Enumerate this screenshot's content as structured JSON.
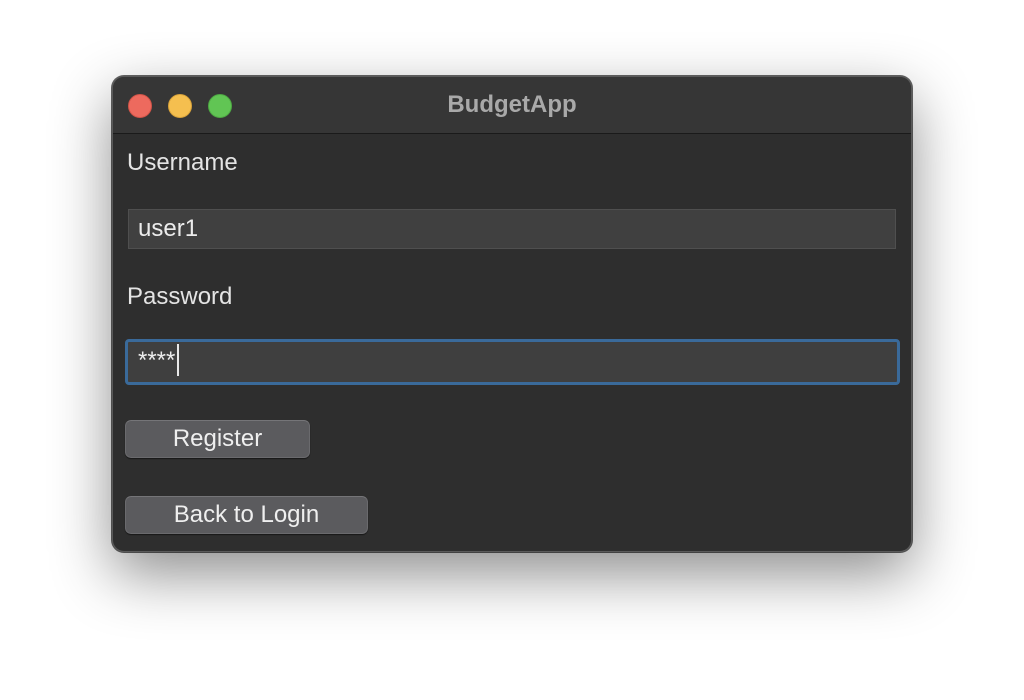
{
  "window": {
    "title": "BudgetApp"
  },
  "form": {
    "username_label": "Username",
    "username_value": "user1",
    "password_label": "Password",
    "password_value": "****"
  },
  "buttons": {
    "register_label": "Register",
    "back_label": "Back to Login"
  },
  "colors": {
    "window_bg": "#2e2e2e",
    "focus_ring": "#3a6a9a",
    "close": "#ed6a5e",
    "minimize": "#f5bf4f",
    "maximize": "#61c554"
  }
}
